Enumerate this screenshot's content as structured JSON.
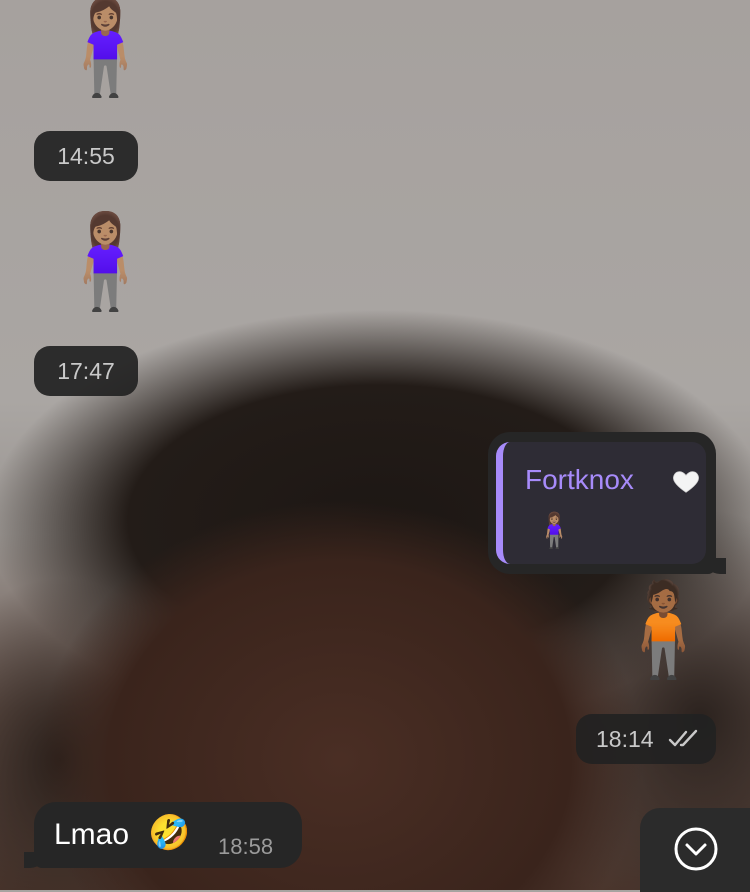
{
  "messages": [
    {
      "type": "emoji",
      "emoji": "🧍🏽‍♀️",
      "time": "14:55",
      "side": "incoming"
    },
    {
      "type": "emoji",
      "emoji": "🧍🏽‍♀️",
      "time": "17:47",
      "side": "incoming"
    },
    {
      "type": "reply",
      "side": "outgoing",
      "quote": {
        "author": "Fortknox",
        "author_emoji": "white-heart",
        "quoted_emoji": "🧍🏽‍♀️"
      },
      "emoji": "🧍🏾",
      "time": "18:14",
      "status": "read"
    },
    {
      "type": "text",
      "text": "Lmao",
      "emoji": "🤣",
      "time": "18:58",
      "side": "incoming"
    }
  ],
  "scroll_down_button": {
    "icon": "chevron-down-circle-icon"
  },
  "colors": {
    "bubble": "#262626",
    "time_pill": "#222222",
    "quote_accent": "#a78bfa",
    "quote_background": "#2e2c35"
  }
}
